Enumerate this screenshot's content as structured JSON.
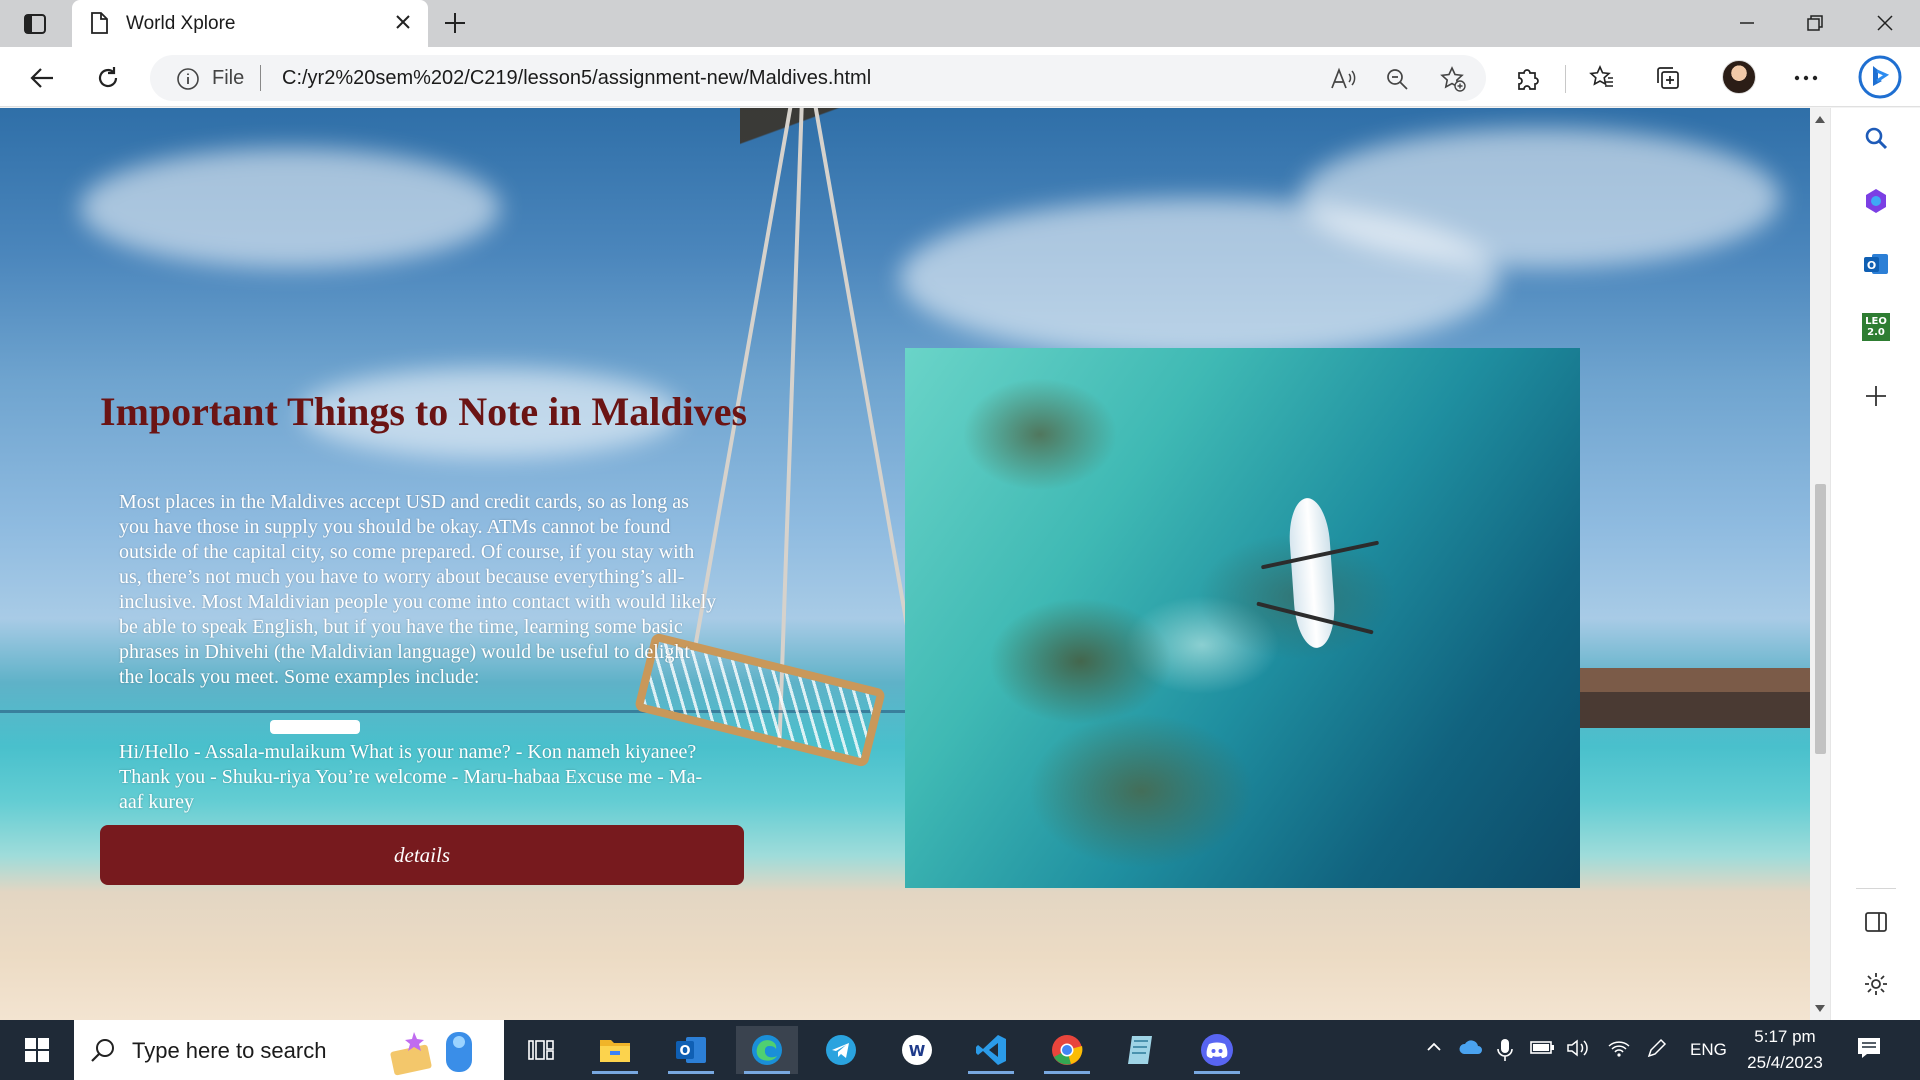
{
  "browser": {
    "tab_title": "World Xplore",
    "address_scheme": "File",
    "url": "C:/yr2%20sem%202/C219/lesson5/assignment-new/Maldives.html"
  },
  "page": {
    "heading": "Important Things to Note in Maldives",
    "paragraph": "Most places in the Maldives accept USD and credit cards, so as long as you have those in supply you should be okay. ATMs cannot be found outside of the capital city, so come prepared. Of course, if you stay with us, there’s not much you have to worry about because everything’s all-inclusive. Most Maldivian people you come into contact with would likely be able to speak English, but if you have the time, learning some basic phrases in Dhivehi (the Maldivian language) would be useful to delight the locals you meet. Some examples include:",
    "phrases": "Hi/Hello - Assala-mulaikum What is your name? - Kon nameh kiyanee? Thank you - Shuku-riya You’re welcome - Maru-habaa Excuse me - Ma-aaf kurey",
    "details_button": "details",
    "heading_color": "#6b1414",
    "button_color": "#771a1e"
  },
  "sidebar": {
    "leo_label": "LEO 2.0"
  },
  "taskbar": {
    "search_placeholder": "Type here to search",
    "language": "ENG",
    "time": "5:17 pm",
    "date": "25/4/2023"
  }
}
